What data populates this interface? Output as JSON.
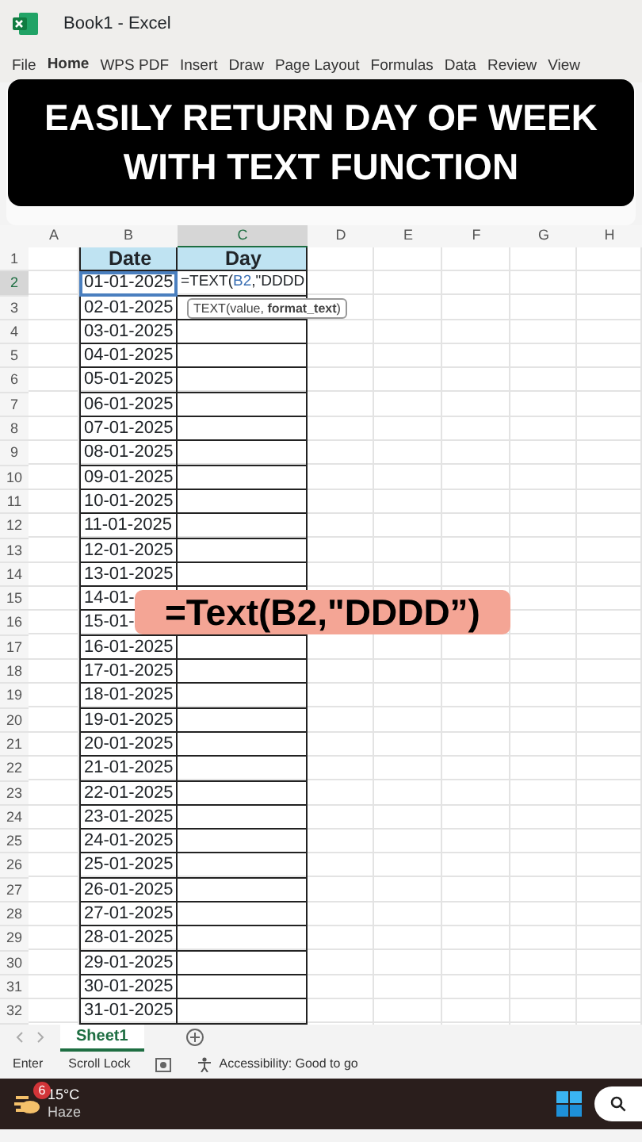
{
  "window": {
    "title": "Book1 - Excel"
  },
  "ribbon_tabs": [
    {
      "label": "File",
      "selected": false
    },
    {
      "label": "Home",
      "selected": true
    },
    {
      "label": "WPS PDF",
      "selected": false
    },
    {
      "label": "Insert",
      "selected": false
    },
    {
      "label": "Draw",
      "selected": false
    },
    {
      "label": "Page Layout",
      "selected": false
    },
    {
      "label": "Formulas",
      "selected": false
    },
    {
      "label": "Data",
      "selected": false
    },
    {
      "label": "Review",
      "selected": false
    },
    {
      "label": "View",
      "selected": false
    }
  ],
  "banner": {
    "lines": [
      "EASILY RETURN DAY OF WEEK",
      "WITH TEXT FUNCTION"
    ]
  },
  "columns": [
    {
      "label": "A",
      "selected": false
    },
    {
      "label": "B",
      "selected": false
    },
    {
      "label": "C",
      "selected": true
    },
    {
      "label": "D",
      "selected": false
    },
    {
      "label": "E",
      "selected": false
    },
    {
      "label": "F",
      "selected": false
    },
    {
      "label": "G",
      "selected": false
    },
    {
      "label": "H",
      "selected": false
    }
  ],
  "header_row": {
    "number": "1",
    "cells": [
      "Date",
      "Day"
    ]
  },
  "formula_cell": {
    "prefix": "=TEXT(",
    "ref": "B2",
    "suffix": ",\"DDDD"
  },
  "tooltip": "TEXT(value, **format_text**)",
  "rows": [
    {
      "number": "2",
      "date": "01-01-2025",
      "selected": true
    },
    {
      "number": "3",
      "date": "02-01-2025",
      "selected": false
    },
    {
      "number": "4",
      "date": "03-01-2025",
      "selected": false
    },
    {
      "number": "5",
      "date": "04-01-2025",
      "selected": false
    },
    {
      "number": "6",
      "date": "05-01-2025",
      "selected": false
    },
    {
      "number": "7",
      "date": "06-01-2025",
      "selected": false
    },
    {
      "number": "8",
      "date": "07-01-2025",
      "selected": false
    },
    {
      "number": "9",
      "date": "08-01-2025",
      "selected": false
    },
    {
      "number": "10",
      "date": "09-01-2025",
      "selected": false
    },
    {
      "number": "11",
      "date": "10-01-2025",
      "selected": false
    },
    {
      "number": "12",
      "date": "11-01-2025",
      "selected": false
    },
    {
      "number": "13",
      "date": "12-01-2025",
      "selected": false
    },
    {
      "number": "14",
      "date": "13-01-2025",
      "selected": false
    },
    {
      "number": "15",
      "date": "14-01-",
      "selected": false
    },
    {
      "number": "16",
      "date": "15-01-",
      "selected": false
    },
    {
      "number": "17",
      "date": "16-01-2025",
      "selected": false
    },
    {
      "number": "18",
      "date": "17-01-2025",
      "selected": false
    },
    {
      "number": "19",
      "date": "18-01-2025",
      "selected": false
    },
    {
      "number": "20",
      "date": "19-01-2025",
      "selected": false
    },
    {
      "number": "21",
      "date": "20-01-2025",
      "selected": false
    },
    {
      "number": "22",
      "date": "21-01-2025",
      "selected": false
    },
    {
      "number": "23",
      "date": "22-01-2025",
      "selected": false
    },
    {
      "number": "24",
      "date": "23-01-2025",
      "selected": false
    },
    {
      "number": "25",
      "date": "24-01-2025",
      "selected": false
    },
    {
      "number": "26",
      "date": "25-01-2025",
      "selected": false
    },
    {
      "number": "27",
      "date": "26-01-2025",
      "selected": false
    },
    {
      "number": "28",
      "date": "27-01-2025",
      "selected": false
    },
    {
      "number": "29",
      "date": "28-01-2025",
      "selected": false
    },
    {
      "number": "30",
      "date": "29-01-2025",
      "selected": false
    },
    {
      "number": "31",
      "date": "30-01-2025",
      "selected": false
    },
    {
      "number": "32",
      "date": "31-01-2025",
      "selected": false
    }
  ],
  "callout": {
    "text": "=Text(B2,\"DDDD”)"
  },
  "sheet_tabs": [
    {
      "label": "Sheet1",
      "selected": true
    }
  ],
  "status_bar": {
    "mode": "Enter",
    "scroll_lock": "Scroll Lock",
    "accessibility": "Accessibility: Good to go"
  },
  "taskbar": {
    "badge": "6",
    "temperature": "15°C",
    "condition": "Haze"
  }
}
